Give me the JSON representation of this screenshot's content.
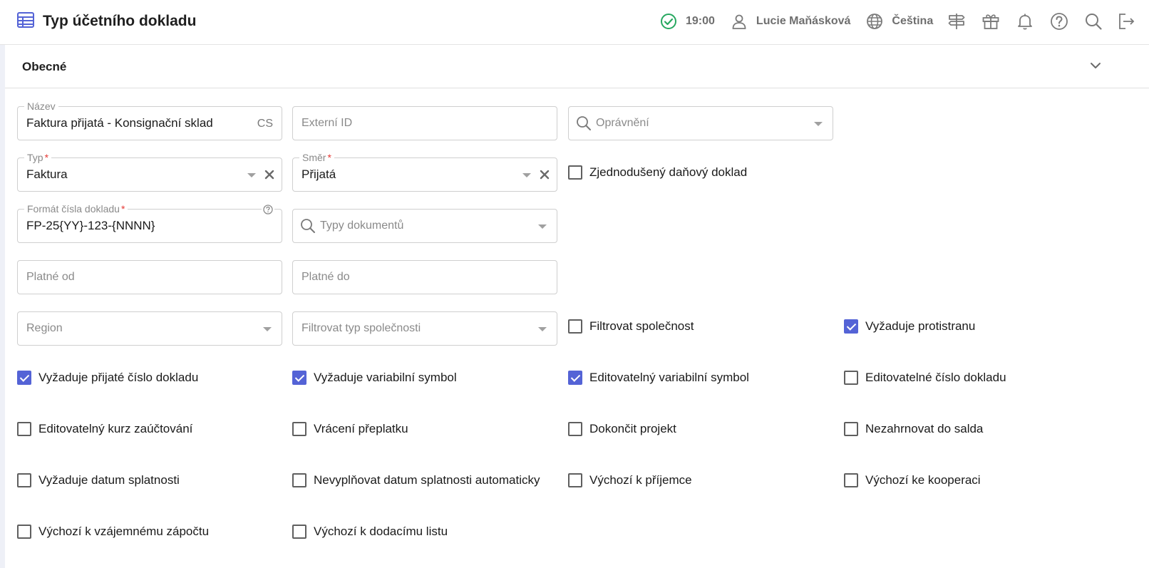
{
  "header": {
    "title": "Typ účetního dokladu",
    "time": "19:00",
    "user": "Lucie Maňásková",
    "language": "Čeština",
    "icons": [
      "table-icon",
      "check-circle-icon",
      "user-icon",
      "globe-icon",
      "signpost-icon",
      "gift-icon",
      "bell-icon",
      "help-icon",
      "search-icon",
      "logout-icon"
    ]
  },
  "colors": {
    "accent": "#5463d6",
    "status_ok": "#27a860",
    "required": "#e53935"
  },
  "section": {
    "title": "Obecné"
  },
  "fields": {
    "nazev": {
      "label": "Název",
      "value": "Faktura přijatá - Konsignační sklad",
      "lang": "CS"
    },
    "externi_id": {
      "placeholder": "Externí ID"
    },
    "opravneni": {
      "placeholder": "Oprávnění"
    },
    "typ": {
      "label": "Typ",
      "required": "*",
      "value": "Faktura"
    },
    "smer": {
      "label": "Směr",
      "required": "*",
      "value": "Přijatá"
    },
    "format": {
      "label": "Formát čísla dokladu",
      "required": "*",
      "value": "FP-25{YY}-123-{NNNN}"
    },
    "typy_dokumentu": {
      "placeholder": "Typy dokumentů"
    },
    "platne_od": {
      "placeholder": "Platné od"
    },
    "platne_do": {
      "placeholder": "Platné do"
    },
    "region": {
      "placeholder": "Region"
    },
    "filtr_typ_spolecnosti": {
      "placeholder": "Filtrovat typ společnosti"
    }
  },
  "checkboxes": {
    "zjednoduseny": {
      "label": "Zjednodušený daňový doklad",
      "checked": false
    },
    "filtrovat_spolecnost": {
      "label": "Filtrovat společnost",
      "checked": false
    },
    "vyzaduje_protistranu": {
      "label": "Vyžaduje protistranu",
      "checked": true
    },
    "vyzaduje_prijate_cislo": {
      "label": "Vyžaduje přijaté číslo dokladu",
      "checked": true
    },
    "vyzaduje_vs": {
      "label": "Vyžaduje variabilní symbol",
      "checked": true
    },
    "editovatelny_vs": {
      "label": "Editovatelný variabilní symbol",
      "checked": true
    },
    "editovatelne_cislo": {
      "label": "Editovatelné číslo dokladu",
      "checked": false
    },
    "editovatelny_kurz": {
      "label": "Editovatelný kurz zaúčtování",
      "checked": false
    },
    "vraceni_preplatku": {
      "label": "Vrácení přeplatku",
      "checked": false
    },
    "dokoncit_projekt": {
      "label": "Dokončit projekt",
      "checked": false
    },
    "nezahrnovat_salda": {
      "label": "Nezahrnovat do salda",
      "checked": false
    },
    "vyzaduje_datum_splatnosti": {
      "label": "Vyžaduje datum splatnosti",
      "checked": false
    },
    "nevyplnovat_datum": {
      "label": "Nevyplňovat datum splatnosti automaticky",
      "checked": false
    },
    "vychozi_prijemce": {
      "label": "Výchozí k příjemce",
      "checked": false
    },
    "vychozi_kooperaci": {
      "label": "Výchozí ke kooperaci",
      "checked": false
    },
    "vychozi_zapoctu": {
      "label": "Výchozí k vzájemnému zápočtu",
      "checked": false
    },
    "vychozi_dodacimu": {
      "label": "Výchozí k dodacímu listu",
      "checked": false
    }
  }
}
